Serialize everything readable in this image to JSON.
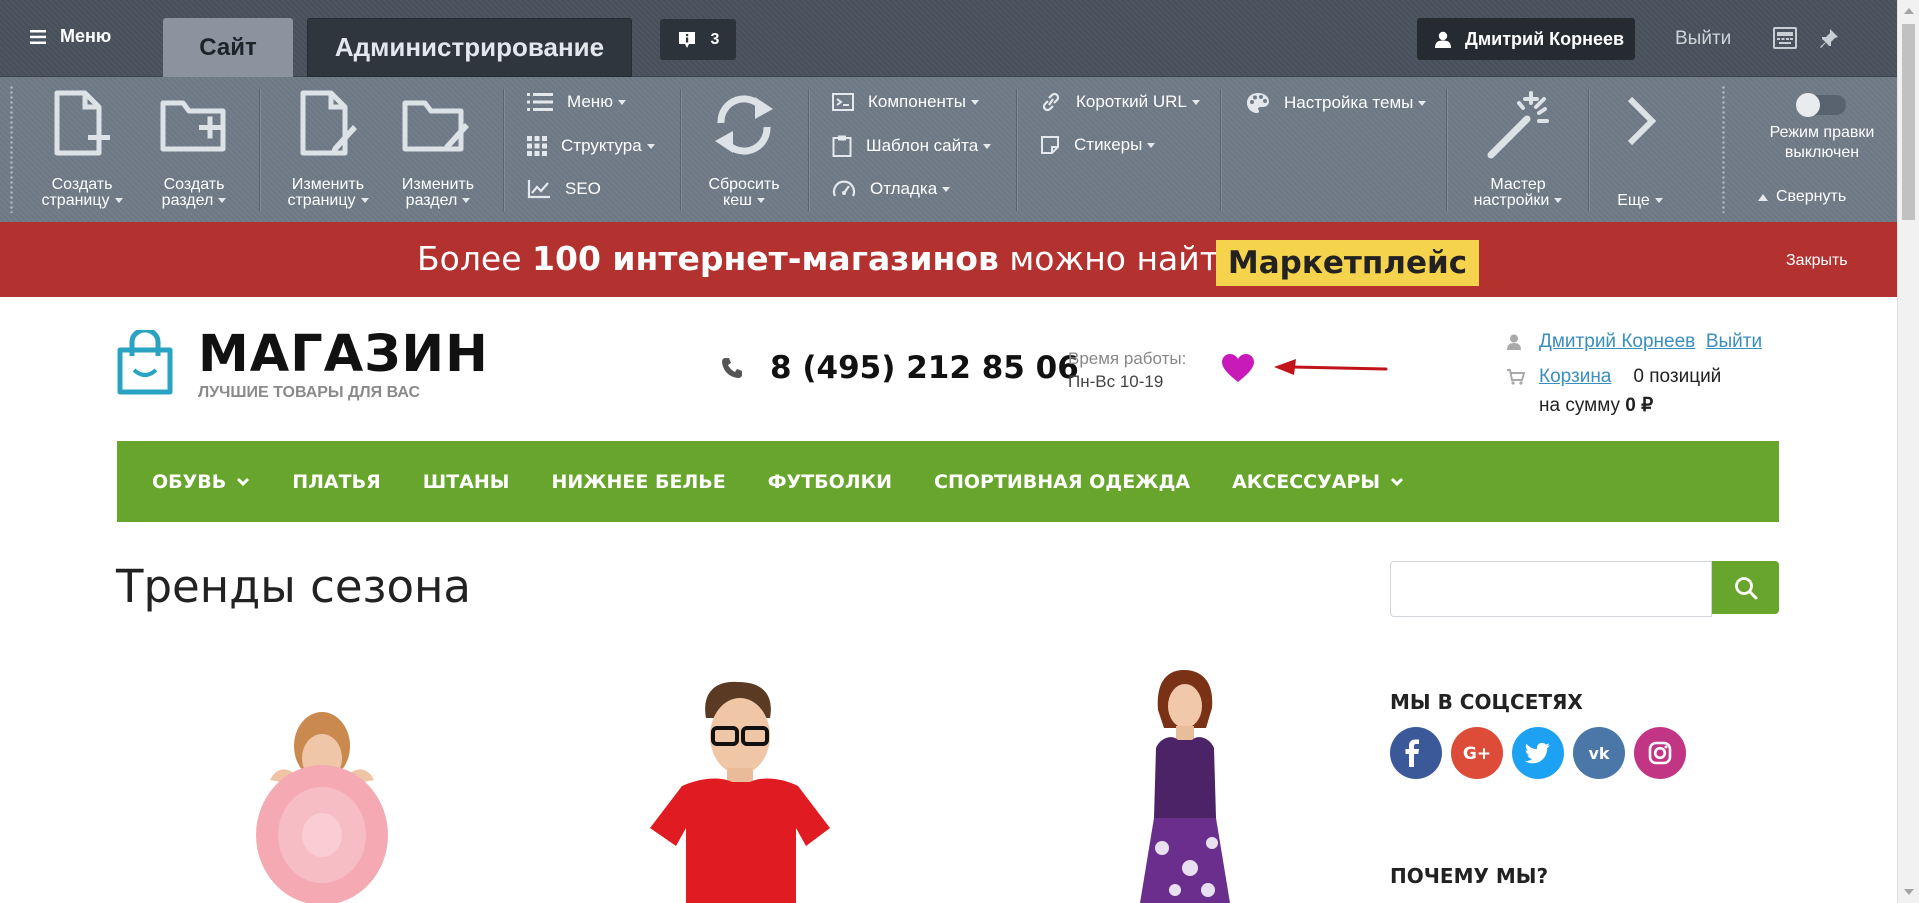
{
  "admin_bar": {
    "menu_label": "Меню",
    "tabs": [
      {
        "label": "Сайт"
      },
      {
        "label": "Администрирование"
      }
    ],
    "notifications_count": "3",
    "user_name": "Дмитрий Корнеев",
    "logout_label": "Выйти"
  },
  "toolbar": {
    "create_page": "Создать\nстраницу",
    "create_section": "Создать\nраздел",
    "edit_page": "Изменить\nстраницу",
    "edit_section": "Изменить\nраздел",
    "menu": "Меню",
    "structure": "Структура",
    "seo": "SEO",
    "reset_cache": "Сбросить\nкеш",
    "components": "Компоненты",
    "site_template": "Шаблон сайта",
    "debug": "Отладка",
    "short_url": "Короткий URL",
    "stickers": "Стикеры",
    "theme_settings": "Настройка темы",
    "setup_wizard": "Мастер\nнастройки",
    "more": "Еще",
    "edit_mode": "Режим правки\nвыключен",
    "collapse": "Свернуть"
  },
  "promo": {
    "text_before": "Более",
    "text_bold": "100 интернет-магазинов",
    "text_after": "можно найти в",
    "badge": "Маркетплейс",
    "close": "Закрыть"
  },
  "header": {
    "logo_title": "МАГАЗИН",
    "logo_subtitle": "ЛУЧШИЕ ТОВАРЫ ДЛЯ ВАС",
    "phone": "8 (495) 212 85 06",
    "hours_label": "Время работы:",
    "hours_value": "Пн-Вс 10-19",
    "user_name": "Дмитрий Корнеев",
    "logout": "Выйти",
    "cart_label": "Корзина",
    "cart_count": "0 позиций",
    "cart_sum_label": "на сумму",
    "cart_sum_value": "0 ₽"
  },
  "nav": [
    {
      "label": "ОБУВЬ",
      "dropdown": true
    },
    {
      "label": "ПЛАТЬЯ",
      "dropdown": false
    },
    {
      "label": "ШТАНЫ",
      "dropdown": false
    },
    {
      "label": "НИЖНЕЕ БЕЛЬЕ",
      "dropdown": false
    },
    {
      "label": "ФУТБОЛКИ",
      "dropdown": false
    },
    {
      "label": "СПОРТИВНАЯ ОДЕЖДА",
      "dropdown": false
    },
    {
      "label": "АКСЕССУАРЫ",
      "dropdown": true
    }
  ],
  "main": {
    "title": "Тренды сезона",
    "search_value": ""
  },
  "sidebar": {
    "social_heading": "МЫ В СОЦСЕТЯХ",
    "socials": [
      {
        "icon": "facebook-icon",
        "color": "#3b5998"
      },
      {
        "icon": "google-plus-icon",
        "color": "#dd4b39"
      },
      {
        "icon": "twitter-icon",
        "color": "#1da1f2"
      },
      {
        "icon": "vk-icon",
        "color": "#4a76a8"
      },
      {
        "icon": "instagram-icon",
        "color": "#c13584"
      }
    ],
    "why_heading": "ПОЧЕМУ МЫ?"
  },
  "colors": {
    "admin_bar": "#49525d",
    "toolbar": "#707b88",
    "promo": "#b3312f",
    "promo_badge": "#f6d34c",
    "nav_green": "#68a52c",
    "link_blue": "#3b8ec0",
    "heart": "#c71ab8",
    "arrow": "#c0141a"
  }
}
